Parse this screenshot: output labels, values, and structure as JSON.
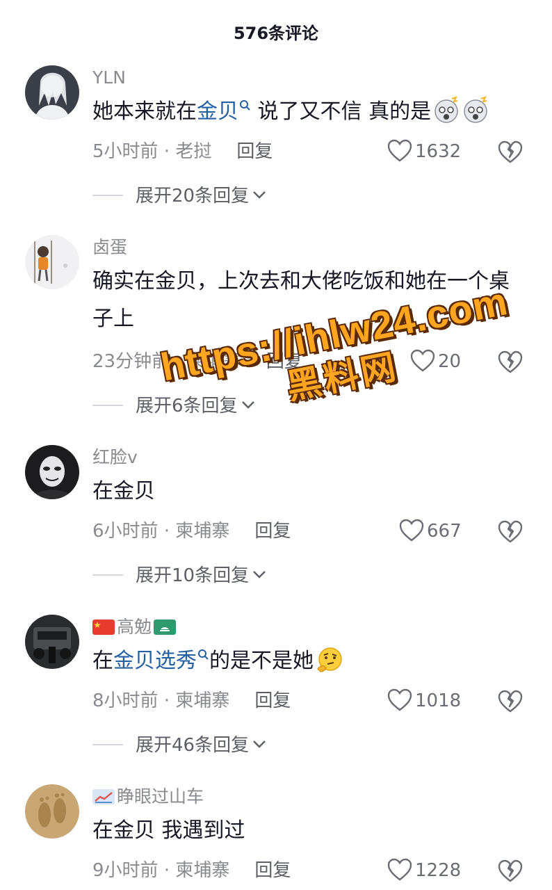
{
  "header": {
    "title": "576条评论"
  },
  "comments": [
    {
      "username": "YLN",
      "body_parts": [
        "她本来就在",
        "金贝",
        " 说了又不信 真的是"
      ],
      "time": "5小时前",
      "location": "老挝",
      "reply_label": "回复",
      "likes": "1632",
      "expand_label": "展开20条回复"
    },
    {
      "username": "卤蛋",
      "body": "确实在金贝，上次去和大佬吃饭和她在一个桌子上",
      "time": "23分钟前",
      "location": "柬埔寨",
      "reply_label": "回复",
      "likes": "20",
      "expand_label": "展开6条回复"
    },
    {
      "username": "红脸v",
      "body": "在金贝",
      "time": "6小时前",
      "location": "柬埔寨",
      "reply_label": "回复",
      "likes": "667",
      "expand_label": "展开10条回复"
    },
    {
      "username": "高勉",
      "body_parts": [
        "在",
        "金贝选秀",
        "的是不是她"
      ],
      "time": "8小时前",
      "location": "柬埔寨",
      "reply_label": "回复",
      "likes": "1018",
      "expand_label": "展开46条回复"
    },
    {
      "username": "睁眼过山车",
      "body": "在金贝 我遇到过",
      "time": "9小时前",
      "location": "柬埔寨",
      "reply_label": "回复",
      "likes": "1228"
    }
  ],
  "watermark": {
    "url": "https://ihlw24.com",
    "name": "黑料网"
  },
  "meta_separator": " · ",
  "colors": {
    "link": "#235fa3",
    "meta": "#8a8b91",
    "watermark": "#ffa51f"
  }
}
